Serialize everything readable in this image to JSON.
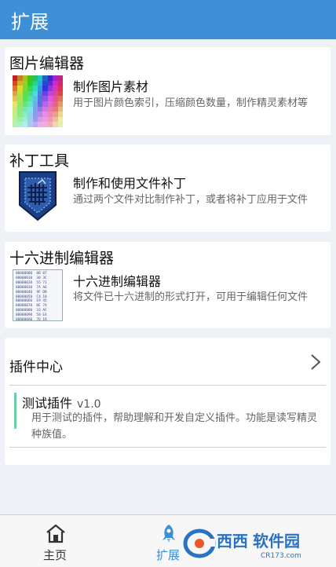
{
  "header": {
    "title": "扩展"
  },
  "cards": [
    {
      "title": "图片编辑器",
      "name": "制作图片素材",
      "desc": "用于图片颜色索引，压缩颜色数量，制作精灵素材等",
      "icon": "pixel-palette-icon"
    },
    {
      "title": "补丁工具",
      "name": "制作和使用文件补丁",
      "desc": "通过两个文件对比制作补丁，或者将补丁应用于文件",
      "icon": "patch-shield-icon"
    },
    {
      "title": "十六进制编辑器",
      "name": "十六进制编辑器",
      "desc": "将文件已十六进制的形式打开，可用于编辑任何文件",
      "icon": "hex-document-icon"
    }
  ],
  "plugin_center": {
    "title": "插件中心",
    "plugin": {
      "name": "测试插件",
      "version": "v1.0",
      "desc": "用于测试的插件，帮助理解和开发自定义插件。功能是读写精灵种族值。"
    }
  },
  "bottom_nav": [
    {
      "label": "主页",
      "icon": "home-icon",
      "active": false
    },
    {
      "label": "扩展",
      "icon": "rocket-icon",
      "active": true
    }
  ],
  "colors": {
    "accent": "#3f8fd6",
    "plugin_bar": "#6ccfa6"
  },
  "watermark": {
    "brand": "西西软件园",
    "domain": "CR173.com"
  }
}
